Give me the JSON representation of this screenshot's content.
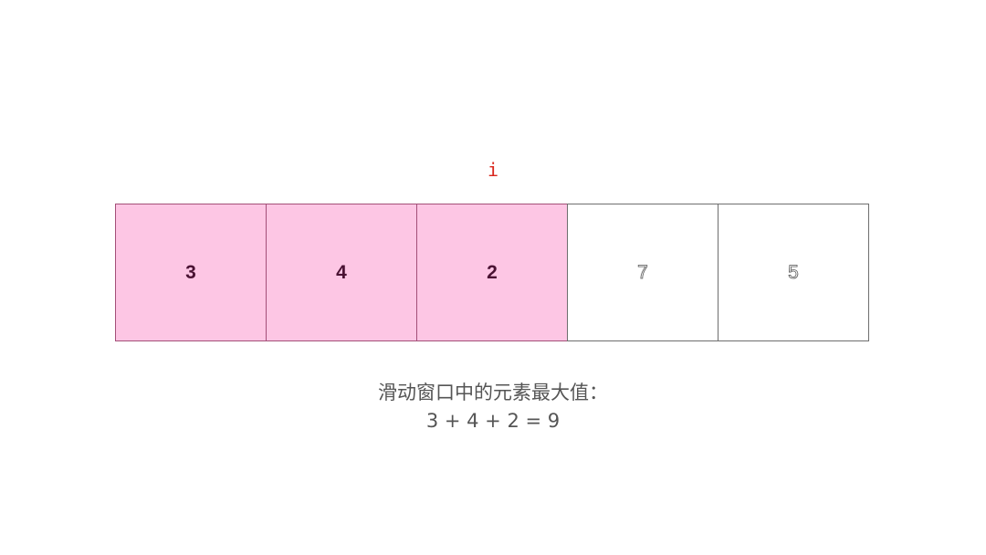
{
  "pointer": {
    "label": "i"
  },
  "array": {
    "cells": [
      {
        "value": "3",
        "in_window": true
      },
      {
        "value": "4",
        "in_window": true
      },
      {
        "value": "2",
        "in_window": true
      },
      {
        "value": "7",
        "in_window": false
      },
      {
        "value": "5",
        "in_window": false
      }
    ]
  },
  "caption": {
    "line1": "滑动窗口中的元素最大值：",
    "line2": "3 + 4 + 2 = 9"
  },
  "colors": {
    "window_fill": "#fdc6e4",
    "window_border": "#a34f78",
    "pointer": "#d9261c",
    "caption": "#555555"
  }
}
